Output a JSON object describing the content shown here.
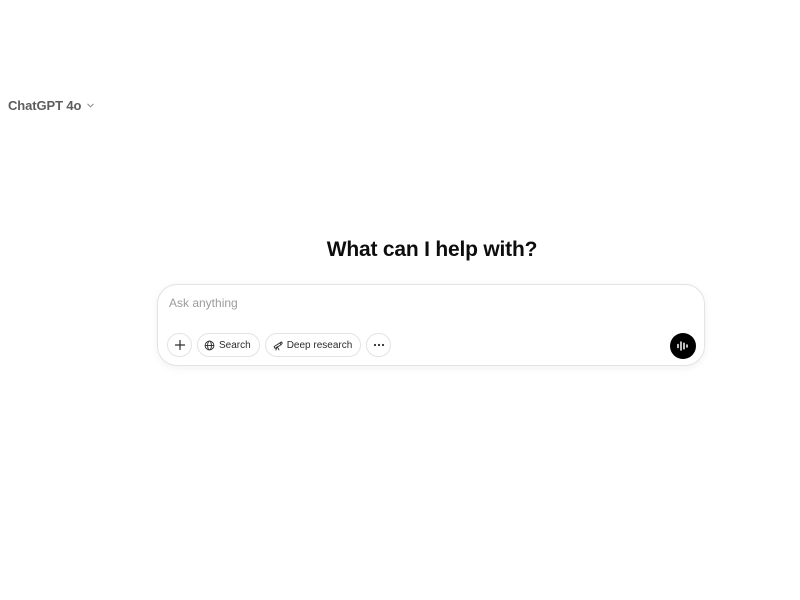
{
  "header": {
    "model_name": "ChatGPT 4o",
    "chevron_icon": "chevron-down-icon"
  },
  "main": {
    "heading": "What can I help with?"
  },
  "composer": {
    "placeholder": "Ask anything",
    "value": "",
    "toolbar": {
      "add_icon": "plus-icon",
      "search_label": "Search",
      "search_icon": "globe-icon",
      "deep_research_label": "Deep research",
      "deep_research_icon": "telescope-icon",
      "more_icon": "more-horizontal-icon"
    },
    "voice_icon": "voice-waveform-icon"
  },
  "colors": {
    "text_primary": "#0d0d0d",
    "text_secondary": "#5d5d5d",
    "placeholder": "#9b9b9b",
    "border": "#e3e3e3",
    "voice_button_bg": "#000000"
  }
}
